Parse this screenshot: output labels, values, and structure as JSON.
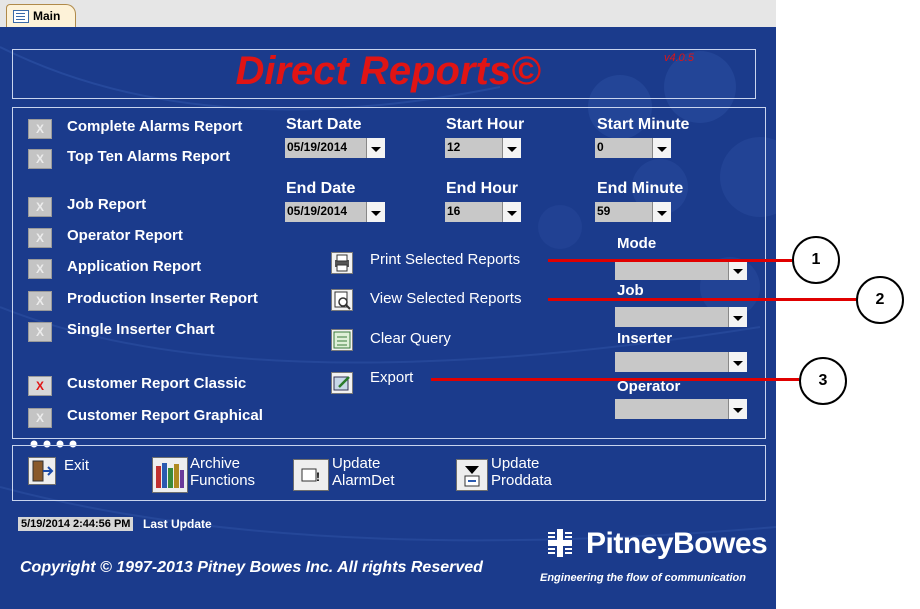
{
  "tab": {
    "label": "Main"
  },
  "title": "Direct Reports©",
  "version": "v4.0.5",
  "reports": [
    {
      "label": "Complete Alarms Report",
      "mark": "X",
      "checked": false
    },
    {
      "label": "Top Ten Alarms Report",
      "mark": "X",
      "checked": false
    },
    {
      "label": "Job Report",
      "mark": "X",
      "checked": false
    },
    {
      "label": "Operator Report",
      "mark": "X",
      "checked": false
    },
    {
      "label": "Application Report",
      "mark": "X",
      "checked": false
    },
    {
      "label": "Production Inserter Report",
      "mark": "X",
      "checked": false
    },
    {
      "label": "Single Inserter Chart",
      "mark": "X",
      "checked": false
    },
    {
      "label": "Customer Report Classic",
      "mark": "X",
      "checked": true
    },
    {
      "label": "Customer Report Graphical",
      "mark": "X",
      "checked": false
    }
  ],
  "filters": {
    "start_date": {
      "label": "Start Date",
      "value": "05/19/2014"
    },
    "start_hour": {
      "label": "Start Hour",
      "value": "12"
    },
    "start_minute": {
      "label": "Start Minute",
      "value": "0"
    },
    "end_date": {
      "label": "End Date",
      "value": "05/19/2014"
    },
    "end_hour": {
      "label": "End Hour",
      "value": "16"
    },
    "end_minute": {
      "label": "End Minute",
      "value": "59"
    }
  },
  "actions": {
    "print": "Print Selected Reports",
    "view": "View Selected Reports",
    "clear": "Clear Query",
    "export": "Export"
  },
  "dropdowns": {
    "mode": {
      "label": "Mode",
      "value": ""
    },
    "job": {
      "label": "Job",
      "value": ""
    },
    "inserter": {
      "label": "Inserter",
      "value": ""
    },
    "operator": {
      "label": "Operator",
      "value": ""
    }
  },
  "bottom_buttons": {
    "exit": "Exit",
    "archive_1": "Archive",
    "archive_2": "Functions",
    "alarm_1": "Update",
    "alarm_2": "AlarmDet",
    "proddata_1": "Update",
    "proddata_2": "Proddata"
  },
  "status": {
    "timestamp": "5/19/2014 2:44:56 PM",
    "label": "Last Update"
  },
  "footer": {
    "copyright": "Copyright © 1997-2013 Pitney Bowes Inc. All rights Reserved",
    "brand": "PitneyBowes",
    "tagline": "Engineering the flow of communication"
  },
  "callouts": [
    "1",
    "2",
    "3"
  ],
  "colors": {
    "panel": "#1b3b8c",
    "title": "#e01414",
    "callout_line": "#e00000"
  }
}
